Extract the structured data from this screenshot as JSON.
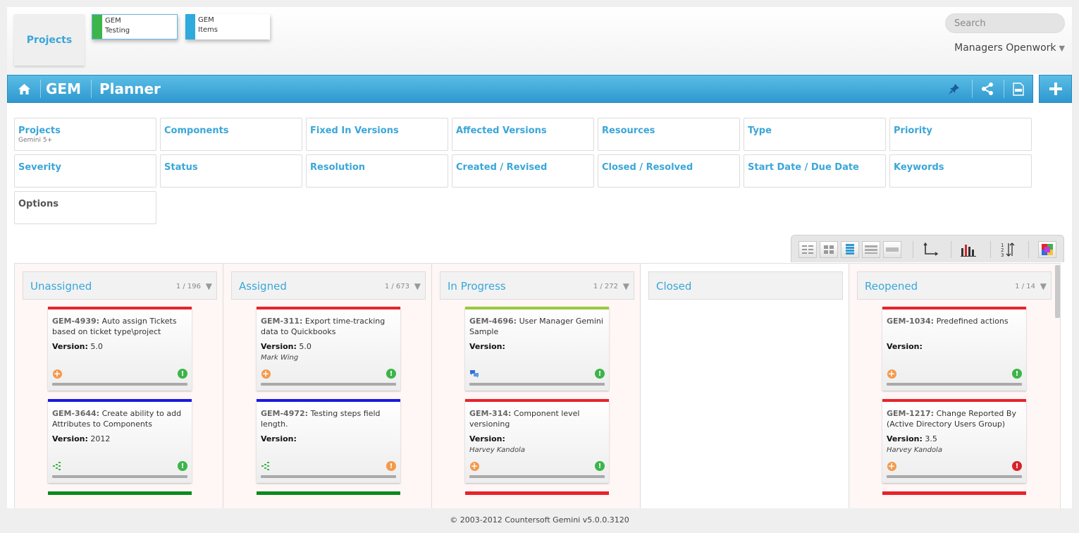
{
  "header": {
    "projects_label": "Projects",
    "project_cards": [
      {
        "line1": "GEM",
        "line2": "Testing",
        "color": "#3cb54a"
      },
      {
        "line1": "GEM",
        "line2": "Items",
        "color": "#2eaadc"
      }
    ],
    "search_placeholder": "Search",
    "workspace_label": "Managers Openwork",
    "workspace_arrow": "▼"
  },
  "titlebar": {
    "project": "GEM",
    "page": "Planner",
    "icons": [
      "home-icon",
      "pin-icon",
      "share-icon",
      "pdf-icon",
      "plus-icon"
    ]
  },
  "filters": [
    {
      "label": "Projects",
      "sub": "Gemini 5+"
    },
    {
      "label": "Components",
      "sub": ""
    },
    {
      "label": "Fixed In Versions",
      "sub": ""
    },
    {
      "label": "Affected Versions",
      "sub": ""
    },
    {
      "label": "Resources",
      "sub": ""
    },
    {
      "label": "Type",
      "sub": ""
    },
    {
      "label": "Priority",
      "sub": ""
    },
    {
      "label": "Severity",
      "sub": ""
    },
    {
      "label": "Status",
      "sub": ""
    },
    {
      "label": "Resolution",
      "sub": ""
    },
    {
      "label": "Created / Revised",
      "sub": ""
    },
    {
      "label": "Closed / Resolved",
      "sub": ""
    },
    {
      "label": "Start Date / Due Date",
      "sub": ""
    },
    {
      "label": "Keywords",
      "sub": ""
    },
    {
      "label": "Options",
      "sub": ""
    }
  ],
  "columns": [
    {
      "title": "Unassigned",
      "count": "1 / 196",
      "cards": [
        {
          "id": "GEM-4939:",
          "text": "Auto assign Tickets based on ticket type\\project",
          "version_label": "Version:",
          "version": "5.0",
          "assignee": "",
          "bar": "#e8232a",
          "left_icon": "add-icon",
          "status_color": "#3cb54a"
        },
        {
          "id": "GEM-3644:",
          "text": "Create ability to add Attributes to Components",
          "version_label": "Version:",
          "version": "2012",
          "assignee": "",
          "bar": "#1a1ae0",
          "left_icon": "hierarchy-icon",
          "status_color": "#3cb54a"
        }
      ],
      "peek": "#0b8a1e"
    },
    {
      "title": "Assigned",
      "count": "1 / 673",
      "cards": [
        {
          "id": "GEM-311:",
          "text": "Export time-tracking data to Quickbooks",
          "version_label": "Version:",
          "version": "5.0",
          "assignee": "Mark Wing",
          "bar": "#e8232a",
          "left_icon": "add-icon",
          "status_color": "#3cb54a"
        },
        {
          "id": "GEM-4972:",
          "text": "Testing steps field length.",
          "version_label": "Version:",
          "version": "",
          "assignee": "",
          "bar": "#1a1ae0",
          "left_icon": "hierarchy-icon",
          "status_color": "#f39a4b"
        }
      ],
      "peek": "#0b8a1e"
    },
    {
      "title": "In Progress",
      "count": "1 / 272",
      "cards": [
        {
          "id": "GEM-4696:",
          "text": "User Manager Gemini Sample",
          "version_label": "Version:",
          "version": "",
          "assignee": "",
          "bar": "#9ac93c",
          "left_icon": "comments-icon",
          "status_color": "#3cb54a"
        },
        {
          "id": "GEM-314:",
          "text": "Component level versioning",
          "version_label": "Version:",
          "version": "",
          "assignee": "Harvey Kandola",
          "bar": "#e8232a",
          "left_icon": "add-icon",
          "status_color": "#3cb54a"
        }
      ],
      "peek": "#e8232a"
    },
    {
      "title": "Closed",
      "count": "",
      "cards": [],
      "peek": ""
    },
    {
      "title": "Reopened",
      "count": "1 / 14",
      "cards": [
        {
          "id": "GEM-1034:",
          "text": "Predefined actions",
          "version_label": "Version:",
          "version": "",
          "assignee": "",
          "bar": "#e8232a",
          "left_icon": "add-icon",
          "status_color": "#3cb54a"
        },
        {
          "id": "GEM-1217:",
          "text": "Change Reported By (Active Directory Users Group)",
          "version_label": "Version:",
          "version": "3.5",
          "assignee": "Harvey Kandola",
          "bar": "#e8232a",
          "left_icon": "add-icon",
          "status_color": "#d9232a"
        }
      ],
      "peek": "#e8232a"
    }
  ],
  "toolbar_icons": [
    "compact-list-icon",
    "small-cards-icon",
    "list-view-icon",
    "rows-view-icon",
    "single-row-icon",
    "axis-icon",
    "bar-chart-icon",
    "sort-order-icon",
    "color-palette-icon"
  ],
  "status_mark": "!",
  "add_mark": "+",
  "footer": {
    "copyright": "© 2003-2012 Countersoft Gemini v5.0.0.3120"
  }
}
